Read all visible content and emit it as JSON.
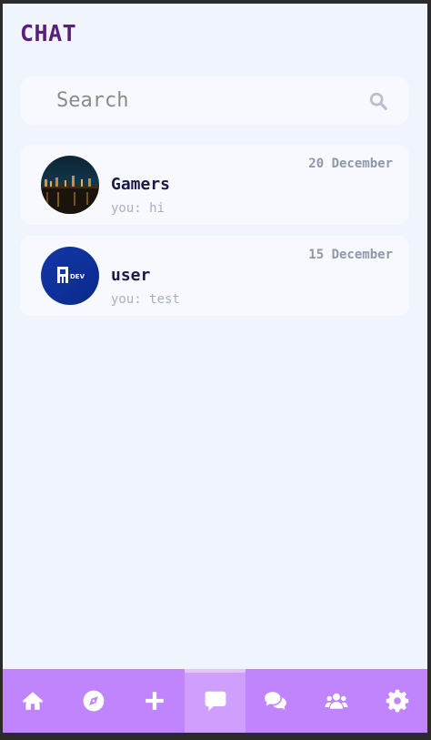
{
  "header": {
    "title": "CHAT"
  },
  "search": {
    "placeholder": "Search"
  },
  "chats": [
    {
      "name": "Gamers",
      "preview": "you: hi",
      "date": "20 December",
      "avatar": "city-night-icon"
    },
    {
      "name": "user",
      "preview": "you: test",
      "date": "15 December",
      "avatar": "dev-logo-icon",
      "avatar_text": "DEV"
    }
  ],
  "nav": {
    "items": [
      {
        "icon": "home-icon"
      },
      {
        "icon": "compass-icon"
      },
      {
        "icon": "plus-icon"
      },
      {
        "icon": "message-icon",
        "active": true
      },
      {
        "icon": "comments-icon"
      },
      {
        "icon": "users-icon"
      },
      {
        "icon": "gear-icon"
      }
    ]
  },
  "colors": {
    "title": "#5a1f7c",
    "nav_bg": "#c084fc",
    "nav_active": "#cf9ffd",
    "background": "#f0f4fc"
  }
}
